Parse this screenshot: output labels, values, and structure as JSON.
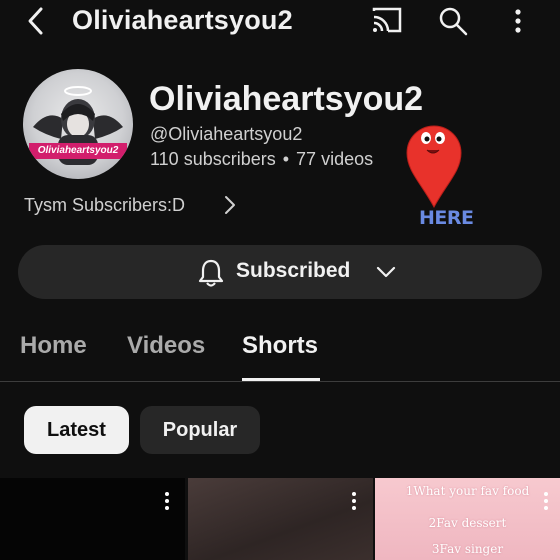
{
  "header": {
    "title": "Oliviaheartsyou2",
    "back_icon": "back-chevron-icon",
    "cast_icon": "cast-icon",
    "search_icon": "search-icon",
    "more_icon": "more-vertical-icon"
  },
  "channel": {
    "name": "Oliviaheartsyou2",
    "handle": "@Oliviaheartsyou2",
    "subscribers": "110 subscribers",
    "separator": "•",
    "videos": "77 videos",
    "avatar_banner": "Oliviaheartsyou2",
    "description": "Tysm Subscribers:D"
  },
  "annotation": {
    "pin_label": "HERE",
    "pin_color": "#e8322b",
    "label_color": "#6a8ae2"
  },
  "subscribe": {
    "label": "Subscribed",
    "bell_icon": "bell-icon",
    "chevron_icon": "chevron-down-icon"
  },
  "tabs": [
    {
      "label": "Home",
      "active": false
    },
    {
      "label": "Videos",
      "active": false
    },
    {
      "label": "Shorts",
      "active": true
    }
  ],
  "filters": {
    "latest": "Latest",
    "popular": "Popular",
    "selected": "Latest"
  },
  "shorts": {
    "third_thumb_lines": [
      "1What your fav food",
      "2Fav dessert",
      "3Fav singer"
    ]
  },
  "colors": {
    "background": "#0f0f0f",
    "surface": "#272727",
    "text_primary": "#f1f1f1",
    "text_secondary": "#aaaaaa"
  }
}
